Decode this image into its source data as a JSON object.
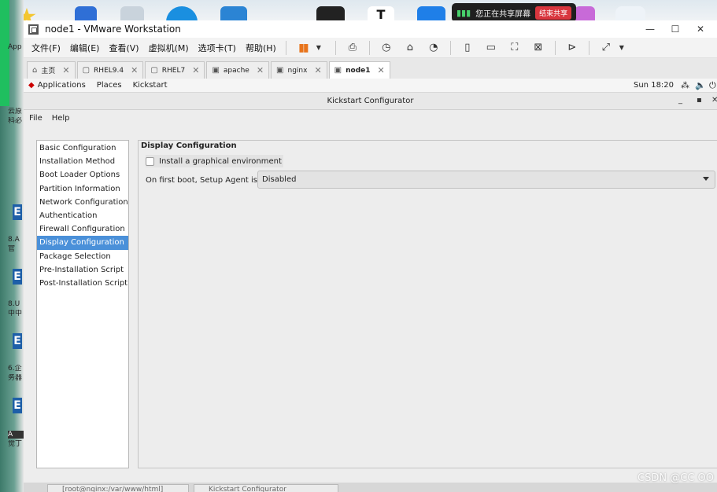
{
  "host": {
    "sidebar_labels": [
      "App",
      "云原",
      "科必",
      "8.A",
      "官",
      "8.U",
      "中中",
      "6.企",
      "务器",
      "A",
      "觉丁"
    ],
    "share": {
      "text": "您正在共享屏幕",
      "stop_label": "结束共享"
    },
    "dock_letter": "T"
  },
  "window": {
    "title": "node1 - VMware Workstation",
    "controls": {
      "minimize": "—",
      "maximize": "☐",
      "close": "✕"
    }
  },
  "menu": [
    "文件(F)",
    "编辑(E)",
    "查看(V)",
    "虚拟机(M)",
    "选项卡(T)",
    "帮助(H)"
  ],
  "tabs": [
    {
      "label": "主页",
      "icon": "home-icon",
      "active": false
    },
    {
      "label": "RHEL9.4",
      "icon": "vm-icon",
      "active": false
    },
    {
      "label": "RHEL7",
      "icon": "vm-icon",
      "active": false
    },
    {
      "label": "apache",
      "icon": "vm-running-icon",
      "active": false
    },
    {
      "label": "nginx",
      "icon": "vm-running-icon",
      "active": false
    },
    {
      "label": "node1",
      "icon": "vm-running-icon",
      "active": true
    }
  ],
  "gnome": {
    "applications": "Applications",
    "places": "Places",
    "kickstart": "Kickstart",
    "clock": "Sun 18:20"
  },
  "ks": {
    "title": "Kickstart Configurator",
    "menu": [
      "File",
      "Help"
    ],
    "sidebar": [
      "Basic Configuration",
      "Installation Method",
      "Boot Loader Options",
      "Partition Information",
      "Network Configuration",
      "Authentication",
      "Firewall Configuration",
      "Display Configuration",
      "Package Selection",
      "Pre-Installation Script",
      "Post-Installation Script"
    ],
    "selected_index": 7,
    "section_title": "Display Configuration",
    "graphical_checkbox_label": "Install a graphical environment",
    "graphical_checked": false,
    "agent_label": "On first boot, Setup Agent is:",
    "agent_value": "Disabled"
  },
  "status": {
    "terminal": "[root@nginx:/var/www/html]",
    "kickstart": "Kickstart Configurator"
  },
  "watermark": "CSDN @CC OO",
  "colors": {
    "selection": "#4a90d9",
    "pause": "#e8741c",
    "share_stop": "#d9363e"
  }
}
